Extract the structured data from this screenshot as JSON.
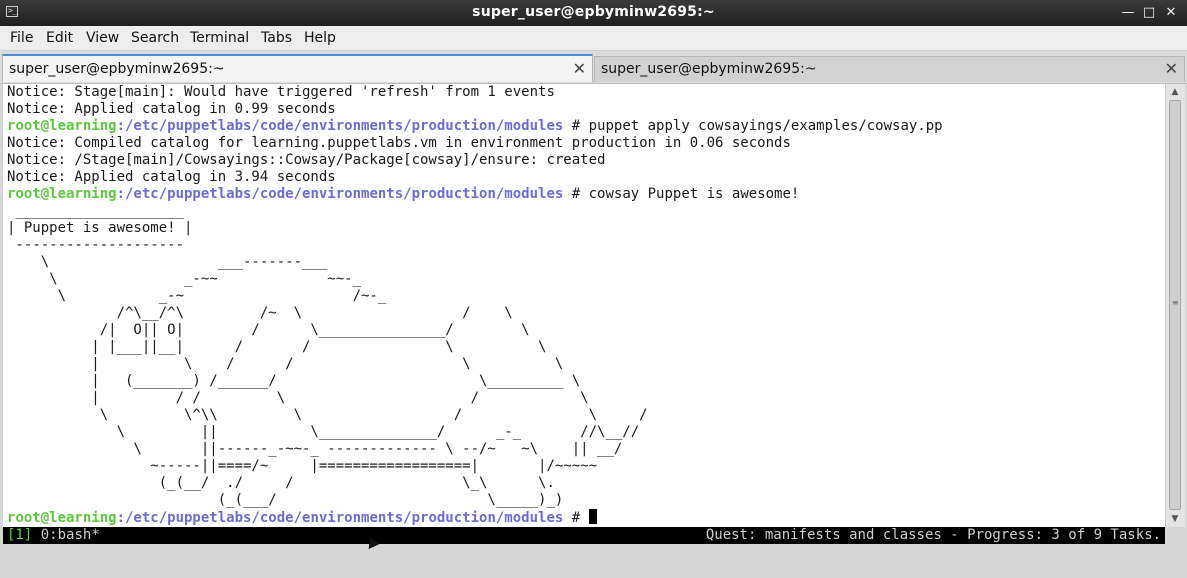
{
  "window": {
    "title": "super_user@epbyminw2695:~",
    "app_icon": "terminal-icon",
    "minimize_glyph": "—",
    "maximize_glyph": "□",
    "close_glyph": "✕"
  },
  "menu": [
    "File",
    "Edit",
    "View",
    "Search",
    "Terminal",
    "Tabs",
    "Help"
  ],
  "tabs": [
    {
      "label": "super_user@epbyminw2695:~",
      "active": true
    },
    {
      "label": "super_user@epbyminw2695:~",
      "active": false
    }
  ],
  "tab_close_glyph": "✕",
  "prompt": {
    "user": "root@learning",
    "path": ":/etc/puppetlabs/code/environments/production/modules",
    "symbol": " # "
  },
  "terminal_lines": [
    {
      "type": "text",
      "text": "Notice: Stage[main]: Would have triggered 'refresh' from 1 events"
    },
    {
      "type": "text",
      "text": "Notice: Applied catalog in 0.99 seconds"
    },
    {
      "type": "prompt",
      "cmd": "puppet apply cowsayings/examples/cowsay.pp"
    },
    {
      "type": "text",
      "text": "Notice: Compiled catalog for learning.puppetlabs.vm in environment production in 0.06 seconds"
    },
    {
      "type": "text",
      "text": "Notice: /Stage[main]/Cowsayings::Cowsay/Package[cowsay]/ensure: created"
    },
    {
      "type": "text",
      "text": "Notice: Applied catalog in 3.94 seconds"
    },
    {
      "type": "prompt",
      "cmd": "cowsay Puppet is awesome!"
    },
    {
      "type": "text",
      "text": " ____________________"
    },
    {
      "type": "text",
      "text": "| Puppet is awesome! |"
    },
    {
      "type": "text",
      "text": " --------------------"
    },
    {
      "type": "text",
      "text": "    \\                    ___-------___"
    },
    {
      "type": "text",
      "text": "     \\               _-~~             ~~-_"
    },
    {
      "type": "text",
      "text": "      \\           _-~                    /~-_"
    },
    {
      "type": "text",
      "text": "             /^\\__/^\\         /~  \\                   /    \\"
    },
    {
      "type": "text",
      "text": "           /|  O|| O|        /      \\_______________/        \\"
    },
    {
      "type": "text",
      "text": "          | |___||__|      /       /                \\          \\"
    },
    {
      "type": "text",
      "text": "          |          \\    /      /                    \\          \\"
    },
    {
      "type": "text",
      "text": "          |   (_______) /______/                        \\_________ \\"
    },
    {
      "type": "text",
      "text": "          |         / /         \\                      /            \\"
    },
    {
      "type": "text",
      "text": "           \\         \\^\\\\         \\                  /               \\     /"
    },
    {
      "type": "text",
      "text": "             \\         ||           \\______________/      _-_       //\\__//"
    },
    {
      "type": "text",
      "text": "               \\       ||------_-~~-_ ------------- \\ --/~   ~\\    || __/"
    },
    {
      "type": "text",
      "text": "                 ~-----||====/~     |==================|       |/~~~~~"
    },
    {
      "type": "text",
      "text": "                  (_(__/  ./     /                    \\_\\      \\."
    },
    {
      "type": "text",
      "text": "                         (_(___/                         \\_____)_)"
    },
    {
      "type": "prompt",
      "cmd": "",
      "cursor": true
    }
  ],
  "status": {
    "window_index": "[1]",
    "window_name": " 0:bash*",
    "right": "Quest: manifests and classes - Progress: 3 of 9 Tasks."
  },
  "scrollbar": {
    "up_glyph": "▲",
    "down_glyph": "▼",
    "grip_glyph": "≡"
  }
}
